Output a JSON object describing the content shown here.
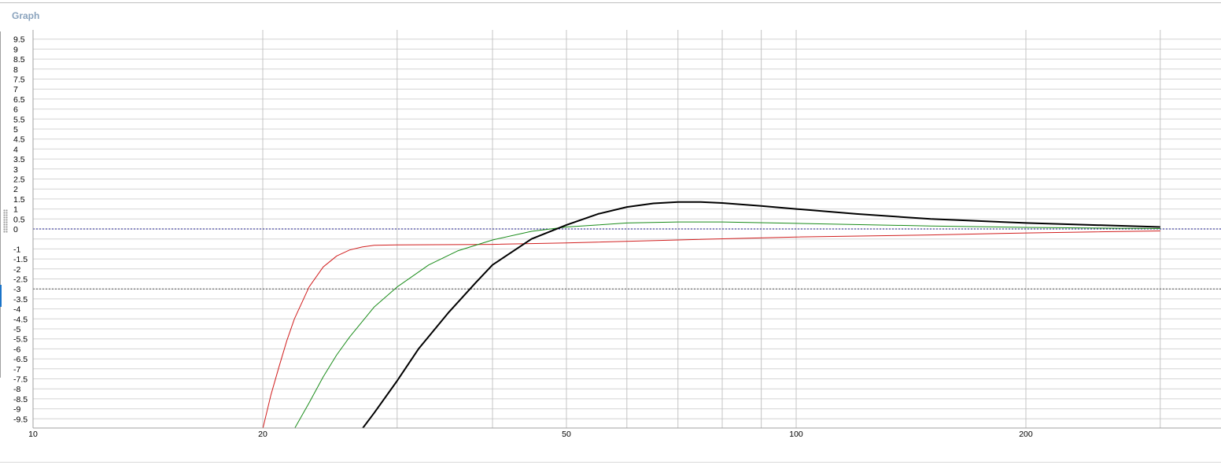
{
  "panel": {
    "title": "Graph"
  },
  "chart_data": {
    "type": "line",
    "xscale": "log",
    "xlim": [
      10,
      310
    ],
    "ylim": [
      -10,
      10
    ],
    "x_ticks": [
      {
        "value": 10,
        "label": "10"
      },
      {
        "value": 20,
        "label": "20"
      },
      {
        "value": 50,
        "label": "50"
      },
      {
        "value": 100,
        "label": "100"
      },
      {
        "value": 200,
        "label": "200"
      }
    ],
    "x_gridlines": [
      10,
      20,
      30,
      40,
      50,
      60,
      70,
      80,
      90,
      100,
      200,
      300
    ],
    "y_ticks": [
      9.5,
      9,
      8.5,
      8,
      7.5,
      7,
      6.5,
      6,
      5.5,
      5,
      4.5,
      4,
      3.5,
      3,
      2.5,
      2,
      1.5,
      1,
      0.5,
      0,
      -1,
      -1.5,
      -2,
      -2.5,
      -3,
      -3.5,
      -4,
      -4.5,
      -5,
      -5.5,
      -6,
      -6.5,
      -7,
      -7.5,
      -8,
      -8.5,
      -9,
      -9.5
    ],
    "reference_lines": [
      {
        "y": 0,
        "style": "dashed",
        "color": "#1c1c8c"
      },
      {
        "y": -3,
        "style": "dashed",
        "color": "#555555"
      }
    ],
    "grid": true,
    "series": [
      {
        "color": "#d11f1f",
        "stroke_width": 1,
        "x": [
          20,
          20.5,
          21,
          21.5,
          22,
          23,
          24,
          25,
          26,
          27,
          28,
          30,
          40,
          50,
          70,
          100,
          150,
          200,
          300
        ],
        "y": [
          -10,
          -8.3,
          -6.9,
          -5.6,
          -4.5,
          -2.9,
          -1.9,
          -1.35,
          -1.05,
          -0.9,
          -0.82,
          -0.8,
          -0.77,
          -0.7,
          -0.55,
          -0.4,
          -0.3,
          -0.2,
          -0.1
        ]
      },
      {
        "color": "#1a8c1a",
        "stroke_width": 1,
        "x": [
          22,
          23,
          24,
          25,
          26,
          28,
          30,
          33,
          36,
          40,
          45,
          50,
          55,
          60,
          70,
          80,
          100,
          150,
          200,
          300
        ],
        "y": [
          -10,
          -8.7,
          -7.4,
          -6.3,
          -5.4,
          -3.9,
          -2.9,
          -1.8,
          -1.1,
          -0.55,
          -0.12,
          0.1,
          0.2,
          0.3,
          0.35,
          0.35,
          0.28,
          0.15,
          0.08,
          0.02
        ]
      },
      {
        "color": "#000000",
        "stroke_width": 2,
        "x": [
          27,
          28,
          30,
          32,
          35,
          38,
          40,
          45,
          50,
          55,
          60,
          65,
          70,
          75,
          80,
          90,
          100,
          120,
          150,
          200,
          300
        ],
        "y": [
          -10,
          -9.2,
          -7.6,
          -6.0,
          -4.2,
          -2.7,
          -1.8,
          -0.5,
          0.2,
          0.75,
          1.1,
          1.28,
          1.35,
          1.35,
          1.3,
          1.15,
          1.0,
          0.75,
          0.5,
          0.3,
          0.1
        ]
      }
    ]
  }
}
